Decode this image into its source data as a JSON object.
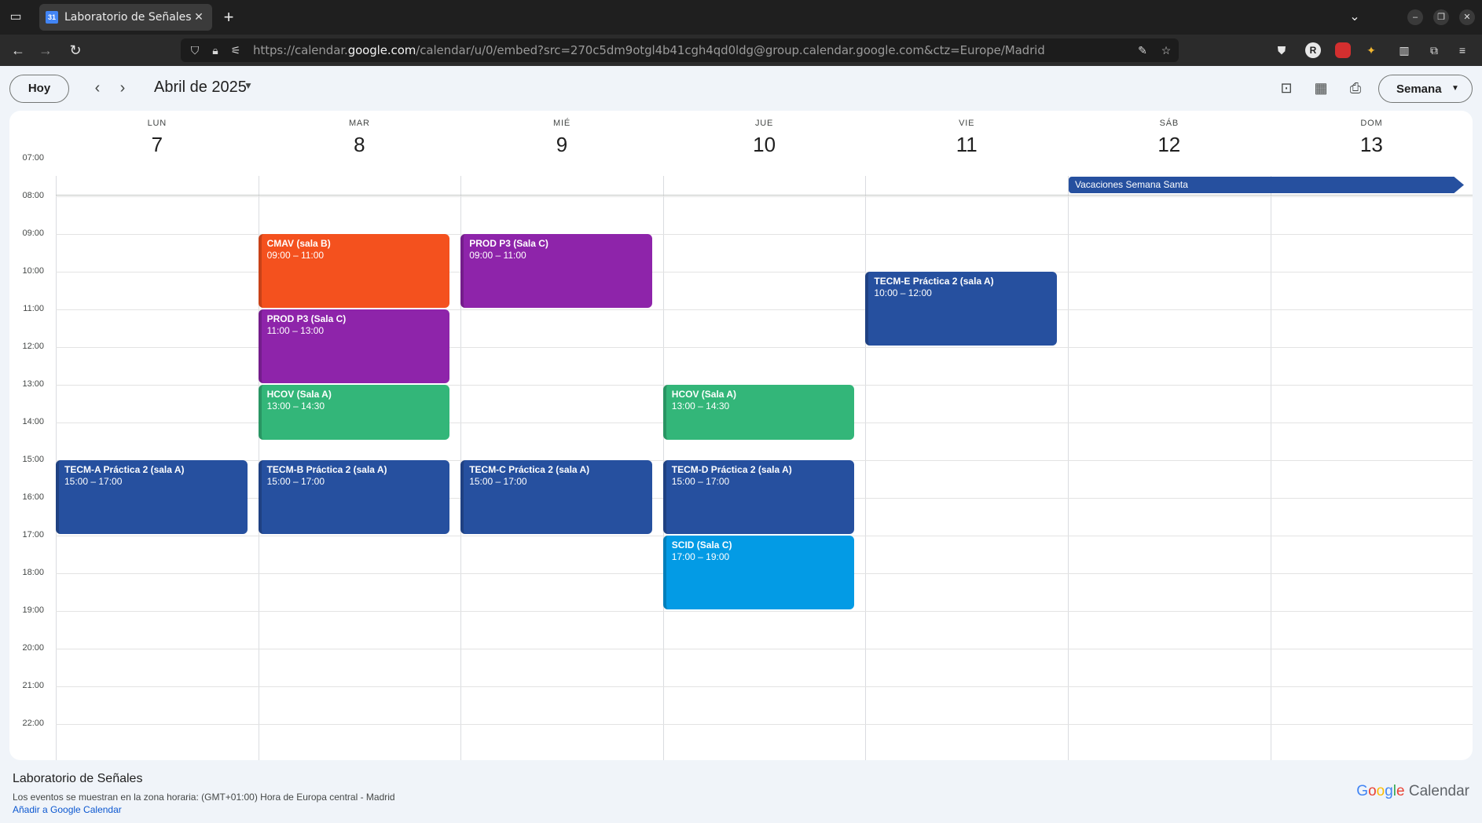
{
  "browser": {
    "tab_title": "Laboratorio de Señales",
    "favicon_text": "31",
    "url_prefix": "https://calendar.",
    "url_host": "google.com",
    "url_rest": "/calendar/u/0/embed?src=270c5dm9otgl4b41cgh4qd0ldg@group.calendar.google.com&ctz=Europe/Madrid",
    "profile_letter": "R"
  },
  "header": {
    "today_label": "Hoy",
    "month_title": "Abril de 2025",
    "view_label": "Semana"
  },
  "days": [
    {
      "name": "LUN",
      "num": "7"
    },
    {
      "name": "MAR",
      "num": "8"
    },
    {
      "name": "MIÉ",
      "num": "9"
    },
    {
      "name": "JUE",
      "num": "10"
    },
    {
      "name": "VIE",
      "num": "11"
    },
    {
      "name": "SÁB",
      "num": "12"
    },
    {
      "name": "DOM",
      "num": "13"
    }
  ],
  "hours": [
    "07:00",
    "08:00",
    "09:00",
    "10:00",
    "11:00",
    "12:00",
    "13:00",
    "14:00",
    "15:00",
    "16:00",
    "17:00",
    "18:00",
    "19:00",
    "20:00",
    "21:00",
    "22:00"
  ],
  "allday_event": {
    "title": "Vacaciones Semana Santa",
    "color": "#26509f"
  },
  "events": [
    {
      "day": 1,
      "start": 9,
      "end": 11,
      "title": "CMAV (sala B)",
      "time": "09:00 – 11:00",
      "color": "#f4511e"
    },
    {
      "day": 1,
      "start": 11,
      "end": 13,
      "title": "PROD P3 (Sala C)",
      "time": "11:00 – 13:00",
      "color": "#8e24aa"
    },
    {
      "day": 1,
      "start": 13,
      "end": 14.5,
      "title": "HCOV (Sala A)",
      "time": "13:00 – 14:30",
      "color": "#33b679"
    },
    {
      "day": 1,
      "start": 15,
      "end": 17,
      "title": "TECM-B Práctica 2 (sala A)",
      "time": "15:00 – 17:00",
      "color": "#26509f"
    },
    {
      "day": 2,
      "start": 9,
      "end": 11,
      "title": "PROD P3 (Sala C)",
      "time": "09:00 – 11:00",
      "color": "#8e24aa"
    },
    {
      "day": 2,
      "start": 15,
      "end": 17,
      "title": "TECM-C Práctica 2 (sala A)",
      "time": "15:00 – 17:00",
      "color": "#26509f"
    },
    {
      "day": 0,
      "start": 15,
      "end": 17,
      "title": "TECM-A Práctica 2 (sala A)",
      "time": "15:00 – 17:00",
      "color": "#26509f"
    },
    {
      "day": 3,
      "start": 13,
      "end": 14.5,
      "title": "HCOV (Sala A)",
      "time": "13:00 – 14:30",
      "color": "#33b679"
    },
    {
      "day": 3,
      "start": 15,
      "end": 17,
      "title": "TECM-D Práctica 2 (sala A)",
      "time": "15:00 – 17:00",
      "color": "#26509f"
    },
    {
      "day": 3,
      "start": 17,
      "end": 19,
      "title": "SCID (Sala C)",
      "time": "17:00 – 19:00",
      "color": "#039be5"
    },
    {
      "day": 4,
      "start": 10,
      "end": 12,
      "title": "TECM-E Práctica 2 (sala A)",
      "time": "10:00 – 12:00",
      "color": "#26509f"
    }
  ],
  "footer": {
    "title": "Laboratorio de Señales",
    "timezone_text": "Los eventos se muestran en la zona horaria: (GMT+01:00) Hora de Europa central - Madrid",
    "add_link": "Añadir a Google Calendar",
    "logo_word": "Calendar"
  }
}
